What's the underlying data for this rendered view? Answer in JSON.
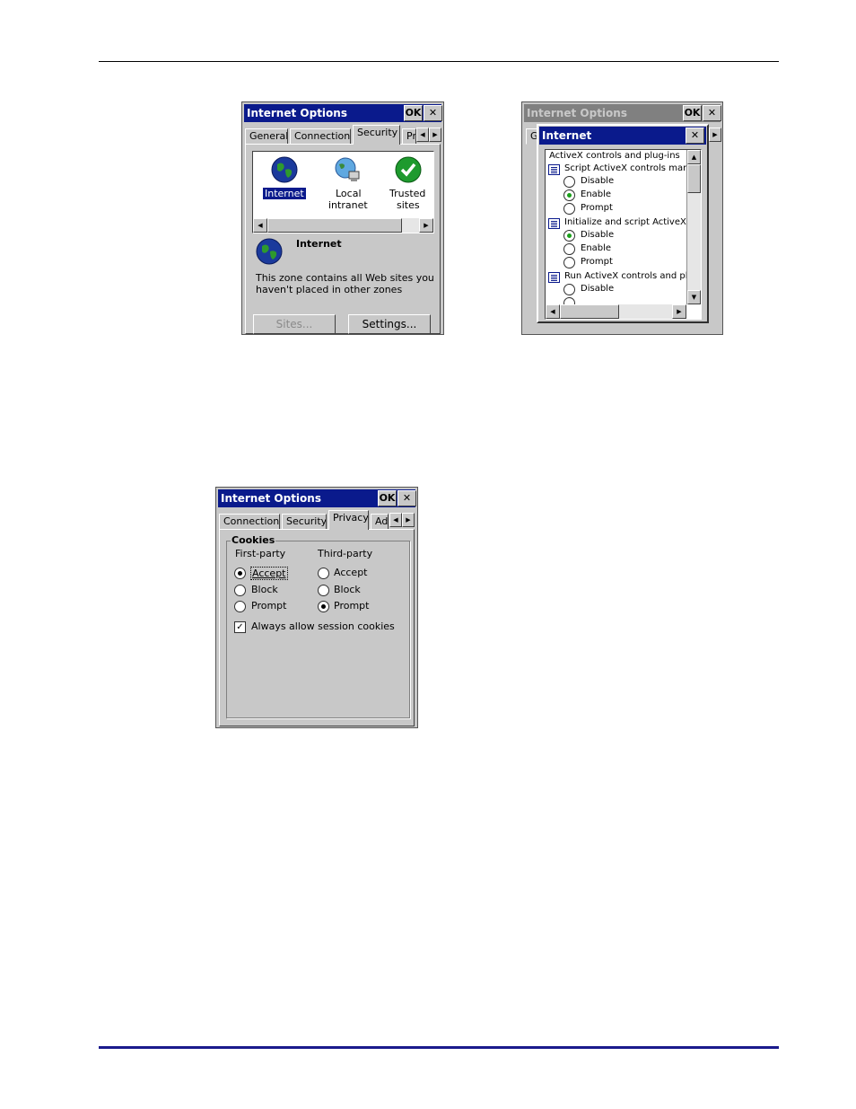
{
  "win1": {
    "title": "Internet Options",
    "ok": "OK",
    "close": "✕",
    "tabs": [
      "General",
      "Connection",
      "Security",
      "Pr"
    ],
    "arrow_left": "◀",
    "arrow_right": "▶",
    "zones": [
      {
        "line1": "Internet",
        "line2": "",
        "icon": "globe-icon"
      },
      {
        "line1": "Local",
        "line2": "intranet",
        "icon": "network-icon"
      },
      {
        "line1": "Trusted",
        "line2": "sites",
        "icon": "checkmark-icon"
      }
    ],
    "zone_name": "Internet",
    "zone_desc_1": "This zone contains all Web sites you",
    "zone_desc_2": "haven't placed in other zones",
    "sites_button": "Sites...",
    "settings_button": "Settings..."
  },
  "win2": {
    "bg_title": "Internet Options",
    "bg_ok": "OK",
    "bg_close": "✕",
    "bg_tab": "G",
    "dlg_title": "Internet",
    "dlg_close": "✕",
    "header": "ActiveX controls and plug-ins",
    "groups": [
      {
        "title": "Script ActiveX controls marked",
        "options": [
          "Disable",
          "Enable",
          "Prompt"
        ],
        "selected": 1
      },
      {
        "title": "Initialize and script ActiveX co",
        "options": [
          "Disable",
          "Enable",
          "Prompt"
        ],
        "selected": 0
      },
      {
        "title": "Run ActiveX controls and plug",
        "options": [
          "Disable"
        ],
        "selected": -1
      }
    ],
    "scroll_up": "▲",
    "scroll_down": "▼",
    "scroll_left": "◀",
    "scroll_right": "▶"
  },
  "win3": {
    "title": "Internet Options",
    "ok": "OK",
    "close": "✕",
    "tabs": [
      "Connection",
      "Security",
      "Privacy",
      "Ad"
    ],
    "arrow_left": "◀",
    "arrow_right": "▶",
    "group_label": "Cookies",
    "first_party": "First-party",
    "third_party": "Third-party",
    "first_options": [
      "Accept",
      "Block",
      "Prompt"
    ],
    "first_selected": 0,
    "third_options": [
      "Accept",
      "Block",
      "Prompt"
    ],
    "third_selected": 2,
    "session_label": "Always allow session cookies",
    "session_checked": true
  }
}
